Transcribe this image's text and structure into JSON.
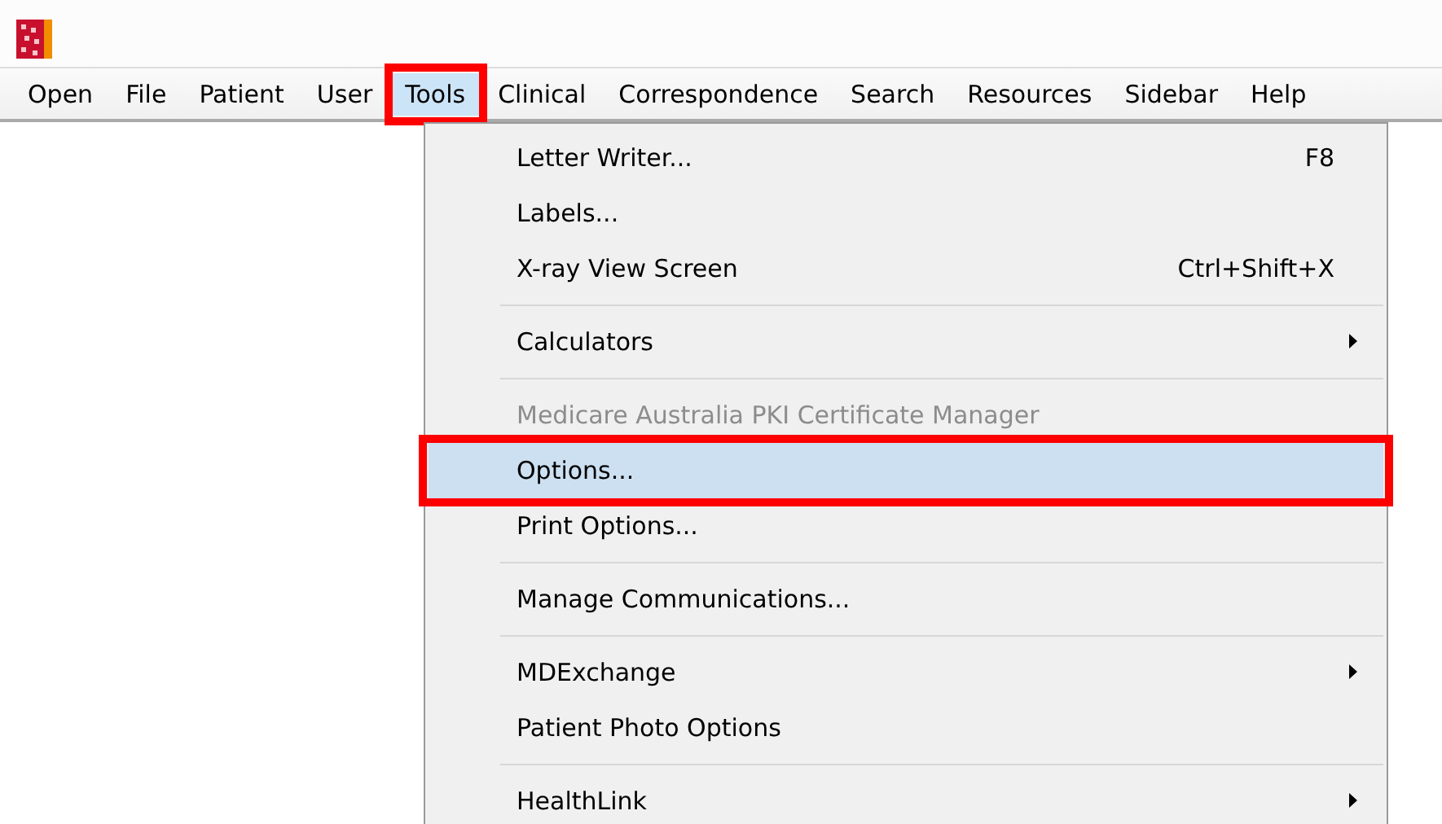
{
  "menubar": [
    {
      "label": "Open",
      "selected": false,
      "annotated": false
    },
    {
      "label": "File",
      "selected": false,
      "annotated": false
    },
    {
      "label": "Patient",
      "selected": false,
      "annotated": false
    },
    {
      "label": "User",
      "selected": false,
      "annotated": false
    },
    {
      "label": "Tools",
      "selected": true,
      "annotated": true
    },
    {
      "label": "Clinical",
      "selected": false,
      "annotated": false
    },
    {
      "label": "Correspondence",
      "selected": false,
      "annotated": false
    },
    {
      "label": "Search",
      "selected": false,
      "annotated": false
    },
    {
      "label": "Resources",
      "selected": false,
      "annotated": false
    },
    {
      "label": "Sidebar",
      "selected": false,
      "annotated": false
    },
    {
      "label": "Help",
      "selected": false,
      "annotated": false
    }
  ],
  "tools_menu": [
    {
      "kind": "item",
      "label": "Letter Writer...",
      "shortcut": "F8",
      "selected": false,
      "disabled": false,
      "submenu": false,
      "annotated": false
    },
    {
      "kind": "item",
      "label": "Labels...",
      "selected": false,
      "disabled": false,
      "submenu": false,
      "annotated": false
    },
    {
      "kind": "item",
      "label": "X-ray View Screen",
      "shortcut": "Ctrl+Shift+X",
      "selected": false,
      "disabled": false,
      "submenu": false,
      "annotated": false
    },
    {
      "kind": "separator"
    },
    {
      "kind": "item",
      "label": "Calculators",
      "selected": false,
      "disabled": false,
      "submenu": true,
      "annotated": false
    },
    {
      "kind": "separator"
    },
    {
      "kind": "item",
      "label": "Medicare Australia PKI Certificate Manager",
      "selected": false,
      "disabled": true,
      "submenu": false,
      "annotated": false
    },
    {
      "kind": "item",
      "label": "Options...",
      "selected": true,
      "disabled": false,
      "submenu": false,
      "annotated": true
    },
    {
      "kind": "item",
      "label": "Print Options...",
      "selected": false,
      "disabled": false,
      "submenu": false,
      "annotated": false
    },
    {
      "kind": "separator"
    },
    {
      "kind": "item",
      "label": "Manage Communications...",
      "selected": false,
      "disabled": false,
      "submenu": false,
      "annotated": false
    },
    {
      "kind": "separator"
    },
    {
      "kind": "item",
      "label": "MDExchange",
      "selected": false,
      "disabled": false,
      "submenu": true,
      "annotated": false
    },
    {
      "kind": "item",
      "label": "Patient Photo Options",
      "selected": false,
      "disabled": false,
      "submenu": false,
      "annotated": false
    },
    {
      "kind": "separator"
    },
    {
      "kind": "item",
      "label": "HealthLink",
      "selected": false,
      "disabled": false,
      "submenu": true,
      "annotated": false
    }
  ]
}
